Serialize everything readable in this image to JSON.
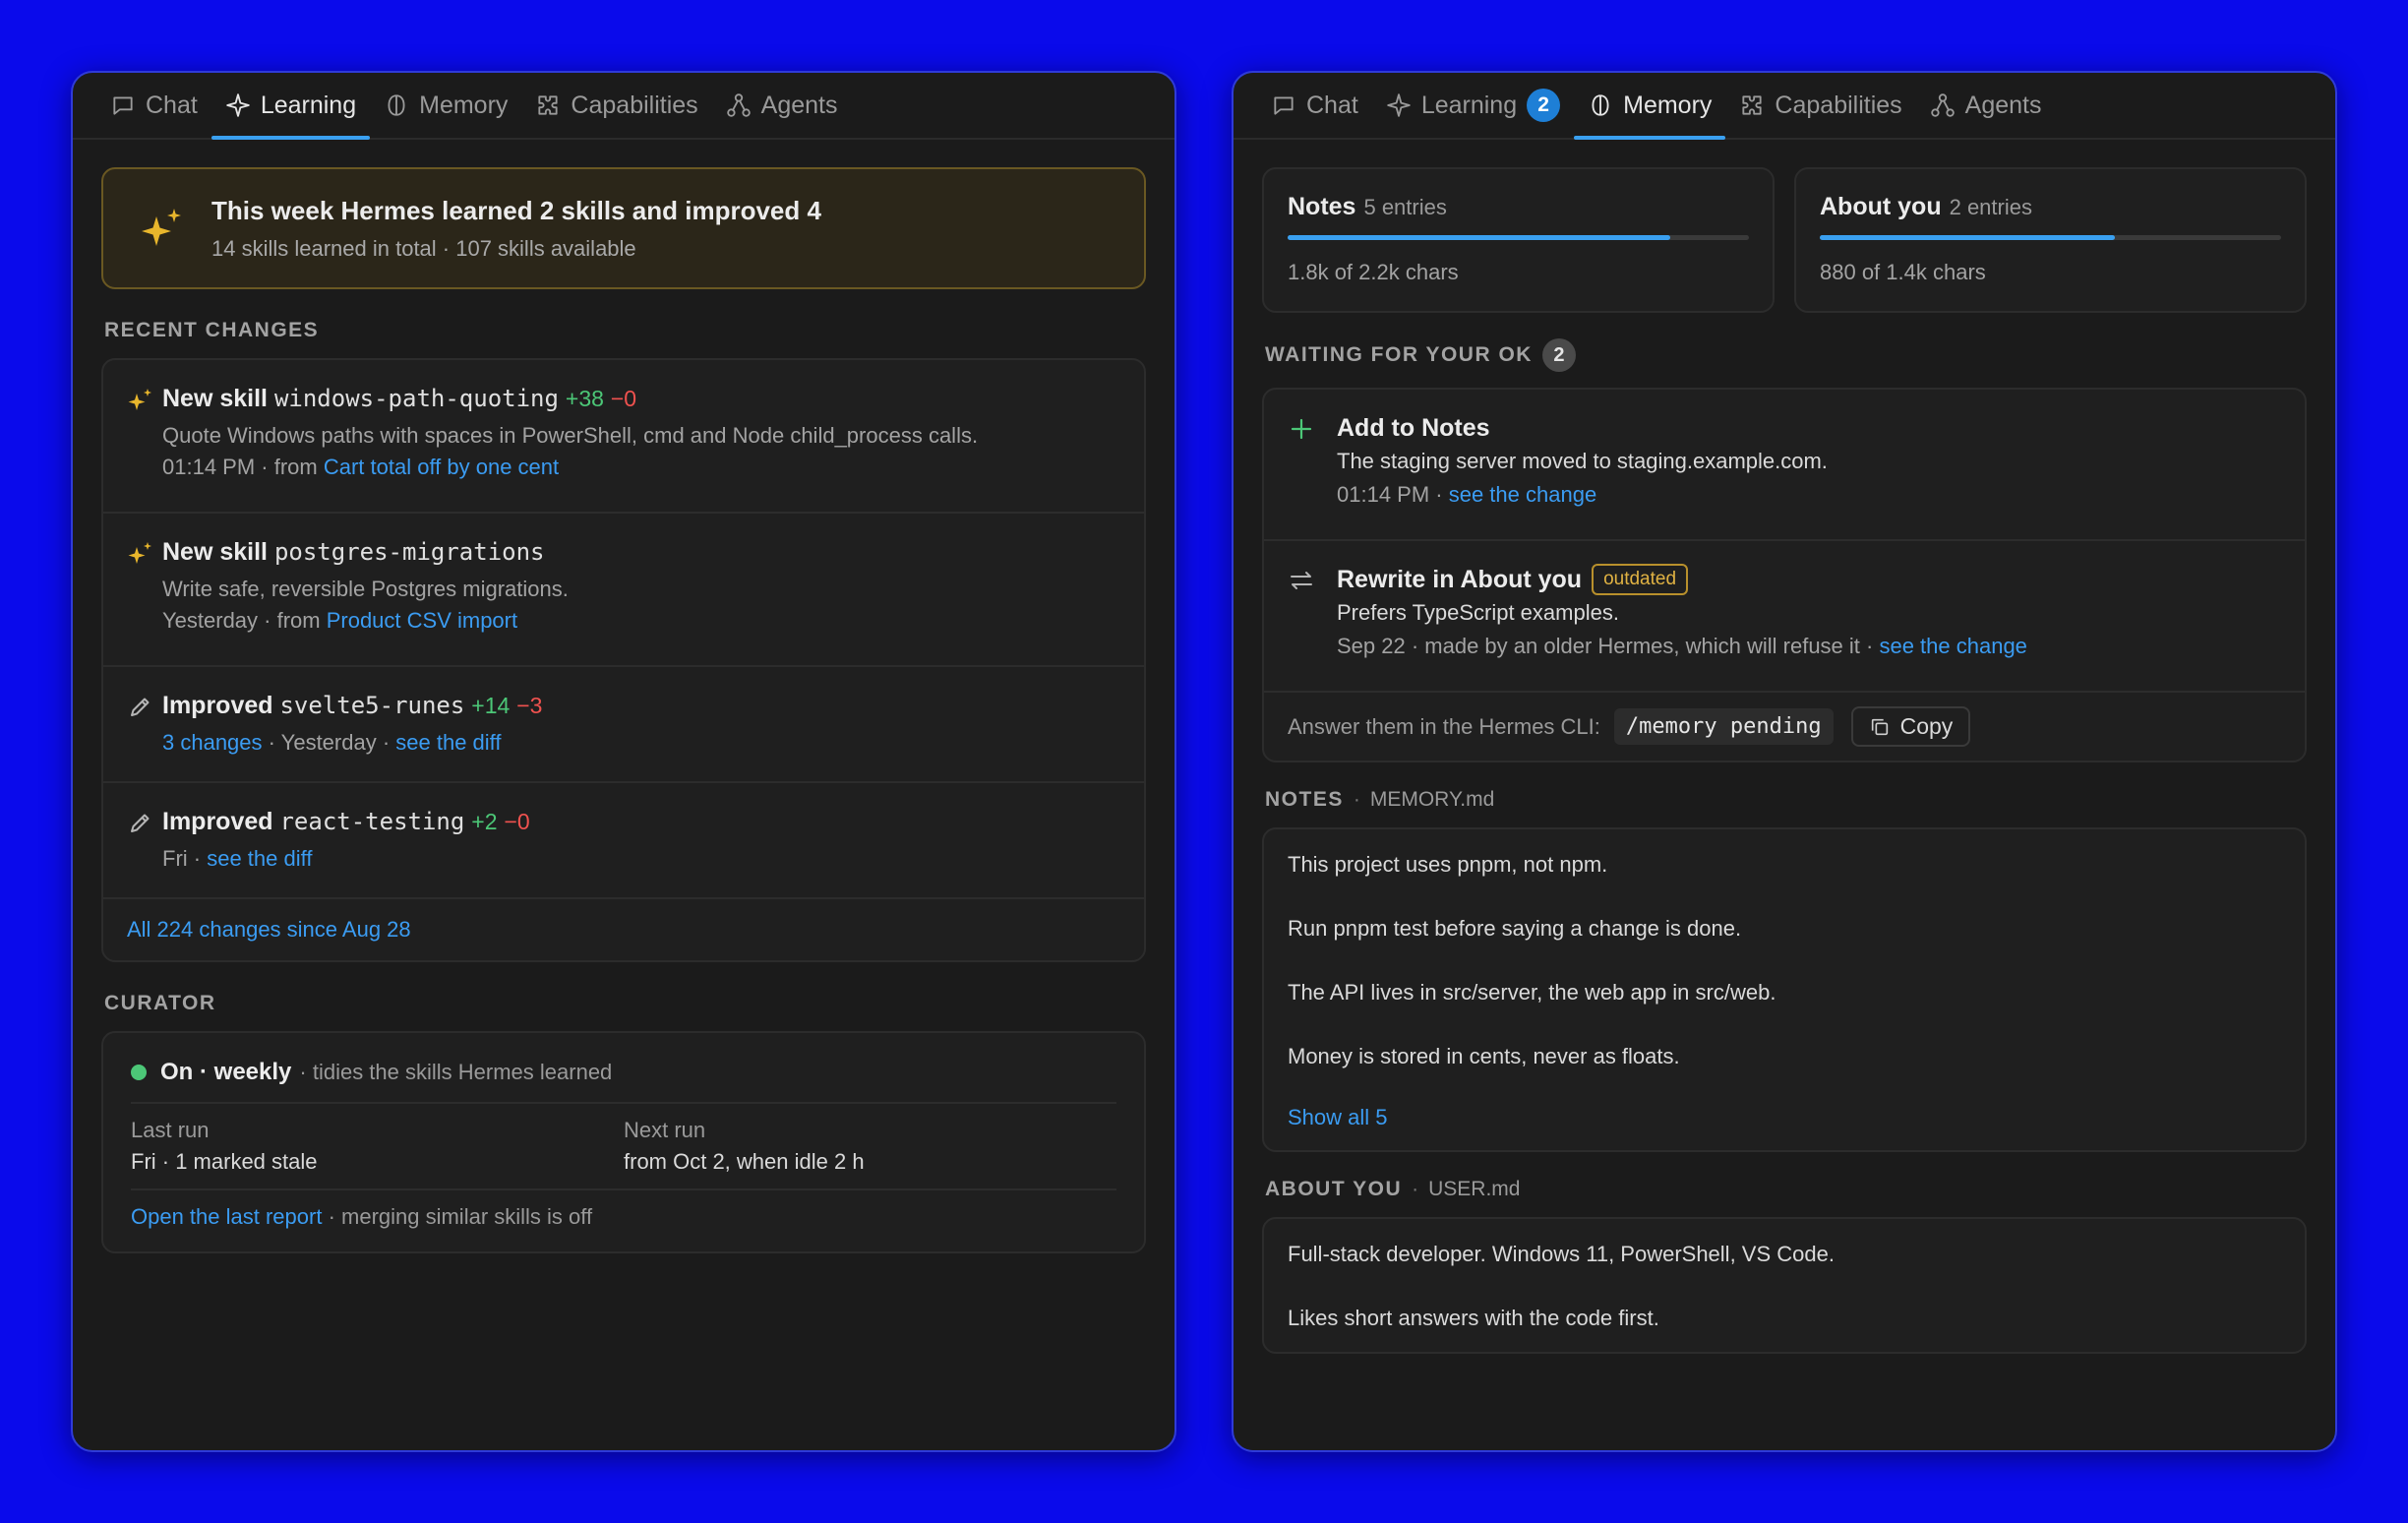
{
  "left": {
    "tabs": [
      {
        "label": "Chat",
        "icon": "chat-icon"
      },
      {
        "label": "Learning",
        "icon": "sparkle-icon",
        "active": true
      },
      {
        "label": "Memory",
        "icon": "brain-icon"
      },
      {
        "label": "Capabilities",
        "icon": "puzzle-icon"
      },
      {
        "label": "Agents",
        "icon": "agents-icon"
      }
    ],
    "banner": {
      "title": "This week Hermes learned 2 skills and improved 4",
      "subtitle": "14 skills learned in total · 107 skills available"
    },
    "recent_changes_label": "RECENT CHANGES",
    "changes": [
      {
        "kind": "New skill",
        "name": "windows-path-quoting",
        "plus": "+38",
        "minus": "−0",
        "desc": "Quote Windows paths with spaces in PowerShell, cmd and Node child_process calls.",
        "meta": "01:14 PM · from ",
        "link": "Cart total off by one cent"
      },
      {
        "kind": "New skill",
        "name": "postgres-migrations",
        "desc": "Write safe, reversible Postgres migrations.",
        "meta": "Yesterday · from ",
        "link": "Product CSV import"
      },
      {
        "kind": "Improved",
        "name": "svelte5-runes",
        "plus": "+14",
        "minus": "−3",
        "meta_link": "3 changes",
        "meta": " · Yesterday · ",
        "link": "see the diff"
      },
      {
        "kind": "Improved",
        "name": "react-testing",
        "plus": "+2",
        "minus": "−0",
        "meta": "Fri · ",
        "link": "see the diff"
      }
    ],
    "all_changes_link": "All 224 changes since Aug 28",
    "curator_label": "CURATOR",
    "curator": {
      "status": "On · weekly",
      "status_desc": " · tidies the skills Hermes learned",
      "last_run_label": "Last run",
      "last_run_value": "Fri · 1 marked stale",
      "next_run_label": "Next run",
      "next_run_value": "from Oct 2, when idle 2 h",
      "report_link": "Open the last report",
      "footer_text": " · merging similar skills is off"
    }
  },
  "right": {
    "tabs": [
      {
        "label": "Chat",
        "icon": "chat-icon"
      },
      {
        "label": "Learning",
        "icon": "sparkle-icon",
        "badge": "2"
      },
      {
        "label": "Memory",
        "icon": "brain-icon",
        "active": true
      },
      {
        "label": "Capabilities",
        "icon": "puzzle-icon"
      },
      {
        "label": "Agents",
        "icon": "agents-icon"
      }
    ],
    "stats": [
      {
        "title": "Notes",
        "count": "5 entries",
        "usage": "1.8k of 2.2k chars",
        "fill": 0.83
      },
      {
        "title": "About you",
        "count": "2 entries",
        "usage": "880 of 1.4k chars",
        "fill": 0.64
      }
    ],
    "waiting_label": "WAITING FOR YOUR OK",
    "waiting_count": "2",
    "waiting": [
      {
        "title": "Add to Notes",
        "text": "The staging server moved to staging.example.com.",
        "meta": "01:14 PM · ",
        "link": "see the change"
      },
      {
        "title": "Rewrite in About you",
        "tag": "outdated",
        "text": "Prefers TypeScript examples.",
        "meta": "Sep 22 · made by an older Hermes, which will refuse it · ",
        "link": "see the change"
      }
    ],
    "cli_text": "Answer them in the Hermes CLI:",
    "cli_command": "/memory pending",
    "copy_label": "Copy",
    "notes_label": "NOTES",
    "notes_file": "MEMORY.md",
    "notes": [
      "This project uses pnpm, not npm.",
      "Run pnpm test before saying a change is done.",
      "The API lives in src/server, the web app in src/web.",
      "Money is stored in cents, never as floats."
    ],
    "show_all": "Show all 5",
    "about_label": "ABOUT YOU",
    "about_file": "USER.md",
    "about": [
      "Full-stack developer. Windows 11, PowerShell, VS Code.",
      "Likes short answers with the code first."
    ]
  },
  "colors": {
    "background": "#0a0aeb",
    "panel": "#1b1b1b",
    "accent": "#3aa0f0",
    "link": "#3b9cf2",
    "plus": "#4cc777",
    "minus": "#f0524f",
    "sparkle": "#e8b62c",
    "warning": "#e0b243"
  }
}
